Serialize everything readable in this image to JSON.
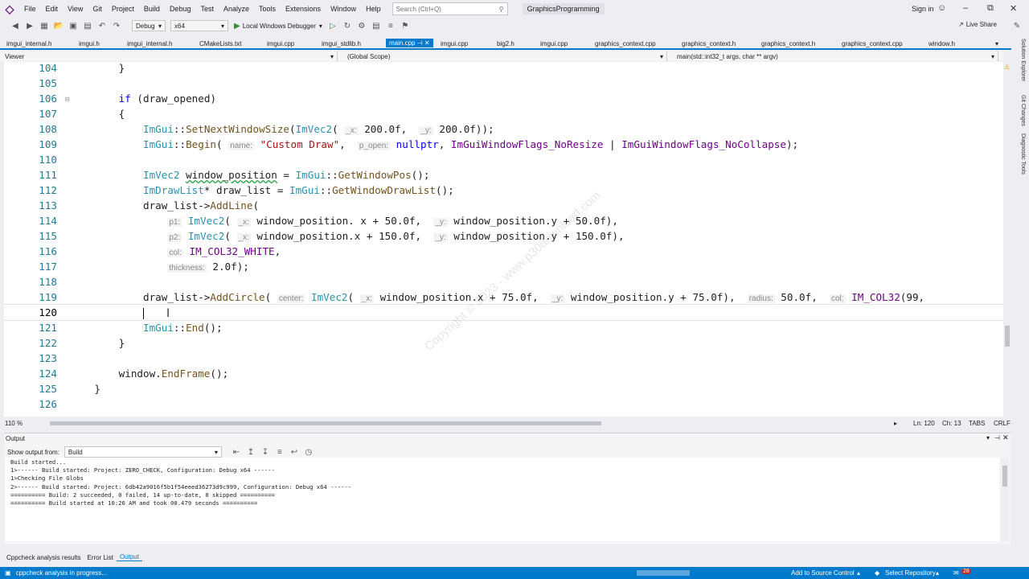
{
  "menu": {
    "items": [
      "File",
      "Edit",
      "View",
      "Git",
      "Project",
      "Build",
      "Debug",
      "Test",
      "Analyze",
      "Tools",
      "Extensions",
      "Window",
      "Help"
    ],
    "search_placeholder": "Search (Ctrl+Q)",
    "solution_name": "GraphicsProgramming",
    "sign_in": "Sign in"
  },
  "toolbar": {
    "config": "Debug",
    "platform": "x64",
    "debugger": "Local Windows Debugger",
    "live_share": "Live Share"
  },
  "tabs": [
    {
      "label": "imgui_internal.h",
      "active": false
    },
    {
      "label": "imgui.h",
      "active": false
    },
    {
      "label": "imgui_internal.h",
      "active": false
    },
    {
      "label": "CMakeLists.txt",
      "active": false
    },
    {
      "label": "imgui.cpp",
      "active": false
    },
    {
      "label": "imgui_stdlib.h",
      "active": false
    },
    {
      "label": "main.cpp",
      "active": true
    },
    {
      "label": "imgui.cpp",
      "active": false
    },
    {
      "label": "big2.h",
      "active": false
    },
    {
      "label": "imgui.cpp",
      "active": false
    },
    {
      "label": "graphics_context.cpp",
      "active": false
    },
    {
      "label": "graphics_context.h",
      "active": false
    },
    {
      "label": "graphics_context.h",
      "active": false
    },
    {
      "label": "graphics_context.cpp",
      "active": false
    },
    {
      "label": "window.h",
      "active": false
    }
  ],
  "navbar": {
    "project": "Viewer",
    "scope": "(Global Scope)",
    "member": "main(std::int32_t args, char ** argv)"
  },
  "editor": {
    "line_numbers": [
      "104",
      "105",
      "106",
      "107",
      "108",
      "109",
      "110",
      "111",
      "112",
      "113",
      "114",
      "115",
      "116",
      "117",
      "118",
      "119",
      "120",
      "121",
      "122",
      "123",
      "124",
      "125",
      "126"
    ],
    "current_line": "120",
    "watermark": "Copyright © 2023 - www.p30download.com"
  },
  "statusbar_editor": {
    "zoom": "110 %",
    "position_line": "Ln: 120",
    "position_col": "Ch: 13",
    "indent": "TABS",
    "eol": "CRLF"
  },
  "output": {
    "title": "Output",
    "show_from_label": "Show output from:",
    "source": "Build",
    "lines": [
      "Build started...",
      "1>------ Build started: Project: ZERO_CHECK, Configuration: Debug x64 ------",
      "1>Checking File Globs",
      "2>------ Build started: Project: 6db42a9016f5b1f54eeed36273d9c999, Configuration: Debug x64 ------",
      "========== Build: 2 succeeded, 0 failed, 14 up-to-date, 0 skipped ==========",
      "========== Build started at 10:26 AM and took 00.479 seconds =========="
    ]
  },
  "bottom_tabs": [
    "Cppcheck analysis results",
    "Error List",
    "Output"
  ],
  "status": {
    "message": "cppcheck analysis in progress...",
    "source_control": "Add to Source Control",
    "repository": "Select Repository",
    "notifications": "28"
  },
  "side_panels": [
    "Solution Explorer",
    "Git Changes",
    "Diagnostic Tools"
  ],
  "colors": {
    "accent": "#007acc",
    "keyword": "#0000ff",
    "type": "#2b91af",
    "string": "#a31515"
  }
}
